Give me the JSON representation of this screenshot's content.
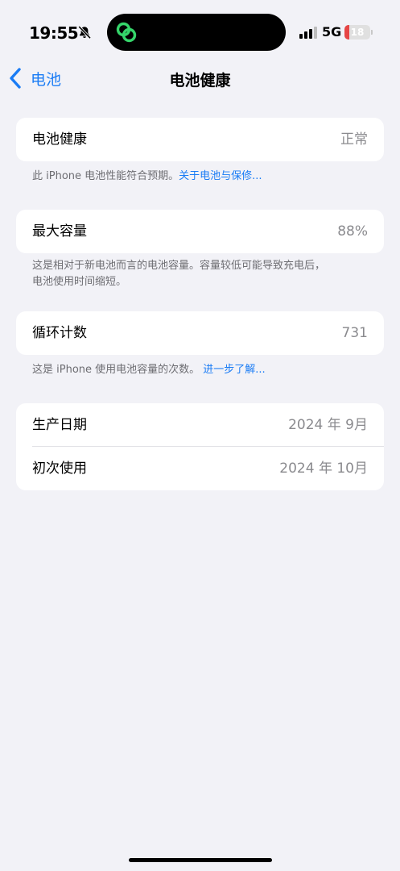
{
  "status_bar": {
    "time": "19:55",
    "network": "5G",
    "battery_level": 18,
    "battery_label": "18",
    "colors": {
      "battery_low": "#E64545",
      "island_icon": "#35D56A"
    },
    "icons": [
      "bell-slash-icon",
      "link-app-icon",
      "cellular-signal-icon",
      "battery-icon"
    ]
  },
  "nav": {
    "back_label": "电池",
    "title": "电池健康"
  },
  "sections": {
    "health": {
      "label": "电池健康",
      "value": "正常",
      "note": "此 iPhone 电池性能符合预期。",
      "link": "关于电池与保修..."
    },
    "capacity": {
      "label": "最大容量",
      "value": "88%",
      "note_line1": "这是相对于新电池而言的电池容量。容量较低可能导致充电后，",
      "note_line2": "电池使用时间缩短。"
    },
    "cycle": {
      "label": "循环计数",
      "value": "731",
      "note": "这是 iPhone 使用电池容量的次数。",
      "link": "进一步了解..."
    },
    "dates": {
      "manufacture_label": "生产日期",
      "manufacture_value": "2024 年 9月",
      "first_use_label": "初次使用",
      "first_use_value": "2024 年 10月"
    }
  },
  "theme": {
    "accent": "#1A7CF5",
    "background": "#F2F2F7",
    "card": "#FFFFFF",
    "secondary_text": "#8A8A8E"
  }
}
